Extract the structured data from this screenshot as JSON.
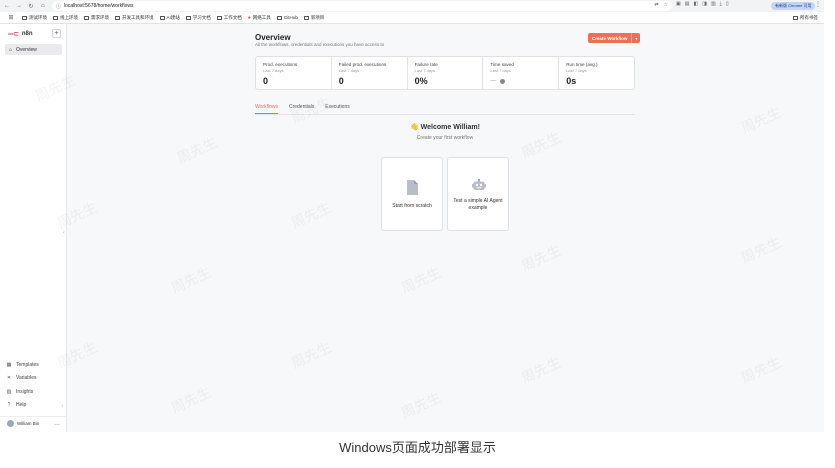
{
  "browser": {
    "url": "localhost:5678/home/workflows",
    "profile_label": "有新版 Chrome 可用",
    "bookmarks": [
      "测试环境",
      "线上环境",
      "需求环境",
      "开发工具和环境",
      "AI建站",
      "学习文档",
      "工作文档",
      "网络工具",
      "GitHub",
      "新项目"
    ],
    "bookmarks_right": "所有书签"
  },
  "sidebar": {
    "logo_text": "n8n",
    "overview_label": "Overview",
    "bottom_items": [
      {
        "label": "Templates",
        "icon": "templates-icon"
      },
      {
        "label": "Variables",
        "icon": "variables-icon"
      },
      {
        "label": "Insights",
        "icon": "insights-icon"
      },
      {
        "label": "Help",
        "icon": "help-icon"
      }
    ],
    "user_name": "William Bin"
  },
  "header": {
    "title": "Overview",
    "subtitle": "All the workflows, credentials and executions you have access to",
    "create_button": "Create Workflow"
  },
  "stats": [
    {
      "name": "Prod. executions",
      "period": "Last 7 days",
      "value": "0"
    },
    {
      "name": "Failed prod. executions",
      "period": "Last 7 days",
      "value": "0"
    },
    {
      "name": "Failure rate",
      "period": "Last 7 days",
      "value": "0%"
    },
    {
      "name": "Time saved",
      "period": "Last 7 days",
      "value": "—"
    },
    {
      "name": "Run time (avg.)",
      "period": "Last 7 days",
      "value": "0s"
    }
  ],
  "tabs": [
    "Workflows",
    "Credentials",
    "Executions"
  ],
  "welcome": {
    "title": "👋 Welcome William!",
    "subtitle": "Create your first workflow"
  },
  "cards": {
    "scratch": "Start from scratch",
    "agent": "Test a simple AI Agent example"
  },
  "watermark": "周先生",
  "caption": "Windows页面成功部署显示"
}
